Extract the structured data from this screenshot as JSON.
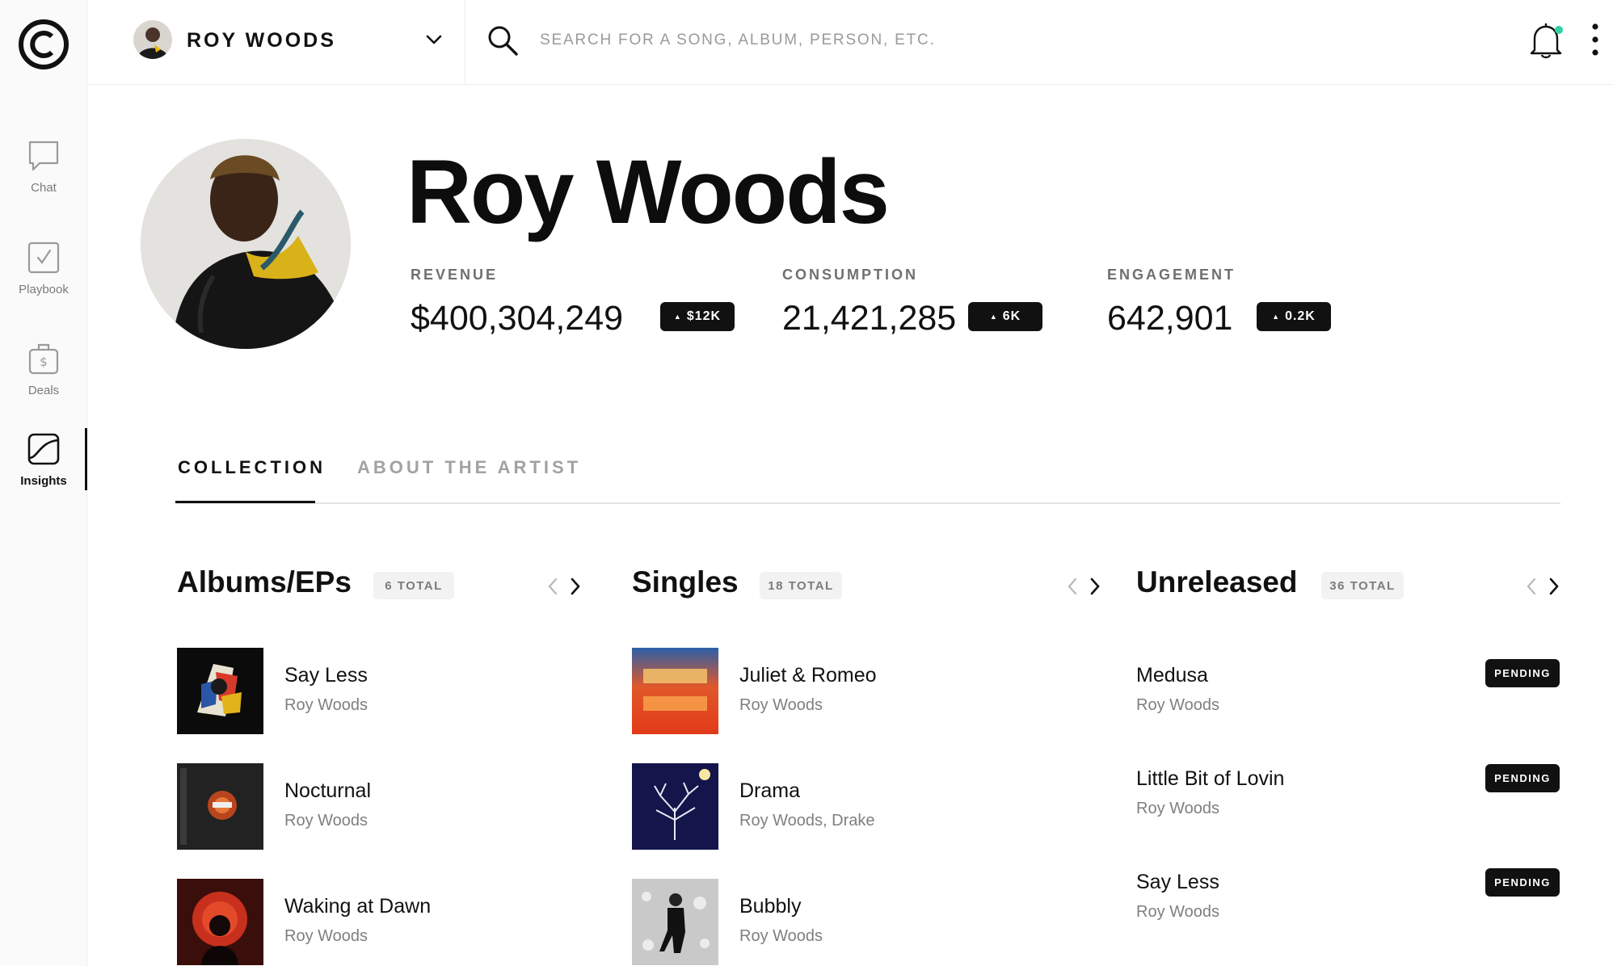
{
  "sidebar": {
    "items": [
      {
        "label": "Chat",
        "icon": "chat-icon"
      },
      {
        "label": "Playbook",
        "icon": "checkbox-icon"
      },
      {
        "label": "Deals",
        "icon": "money-bag-icon"
      },
      {
        "label": "Insights",
        "icon": "chart-icon",
        "active": true
      }
    ]
  },
  "topbar": {
    "artist_name": "ROY WOODS",
    "search_placeholder": "SEARCH FOR A SONG, ALBUM, PERSON, ETC.",
    "search_value": ""
  },
  "header": {
    "title": "Roy Woods",
    "metrics": [
      {
        "label": "REVENUE",
        "value": "$400,304,249",
        "change": "$12K"
      },
      {
        "label": "CONSUMPTION",
        "value": "21,421,285",
        "change": "6K"
      },
      {
        "label": "ENGAGEMENT",
        "value": "642,901",
        "change": "0.2K"
      }
    ]
  },
  "tabs": [
    {
      "label": "COLLECTION",
      "active": true
    },
    {
      "label": "ABOUT THE ARTIST",
      "active": false
    }
  ],
  "columns": {
    "albums": {
      "title": "Albums/EPs",
      "count": "6 TOTAL",
      "items": [
        {
          "title": "Say Less",
          "artist": "Roy Woods"
        },
        {
          "title": "Nocturnal",
          "artist": "Roy Woods"
        },
        {
          "title": "Waking at Dawn",
          "artist": "Roy Woods"
        }
      ]
    },
    "singles": {
      "title": "Singles",
      "count": "18 TOTAL",
      "items": [
        {
          "title": "Juliet & Romeo",
          "artist": "Roy Woods"
        },
        {
          "title": "Drama",
          "artist": "Roy Woods, Drake"
        },
        {
          "title": "Bubbly",
          "artist": "Roy Woods"
        }
      ]
    },
    "unreleased": {
      "title": "Unreleased",
      "count": "36 TOTAL",
      "items": [
        {
          "title": "Medusa",
          "artist": "Roy Woods",
          "status": "PENDING"
        },
        {
          "title": "Little Bit of Lovin",
          "artist": "Roy Woods",
          "status": "PENDING"
        },
        {
          "title": "Say Less",
          "artist": "Roy Woods",
          "status": "PENDING"
        }
      ]
    }
  },
  "colors": {
    "accent": "#111111",
    "notification_dot": "#2ED3A3",
    "muted_text": "#7F7F7F"
  }
}
